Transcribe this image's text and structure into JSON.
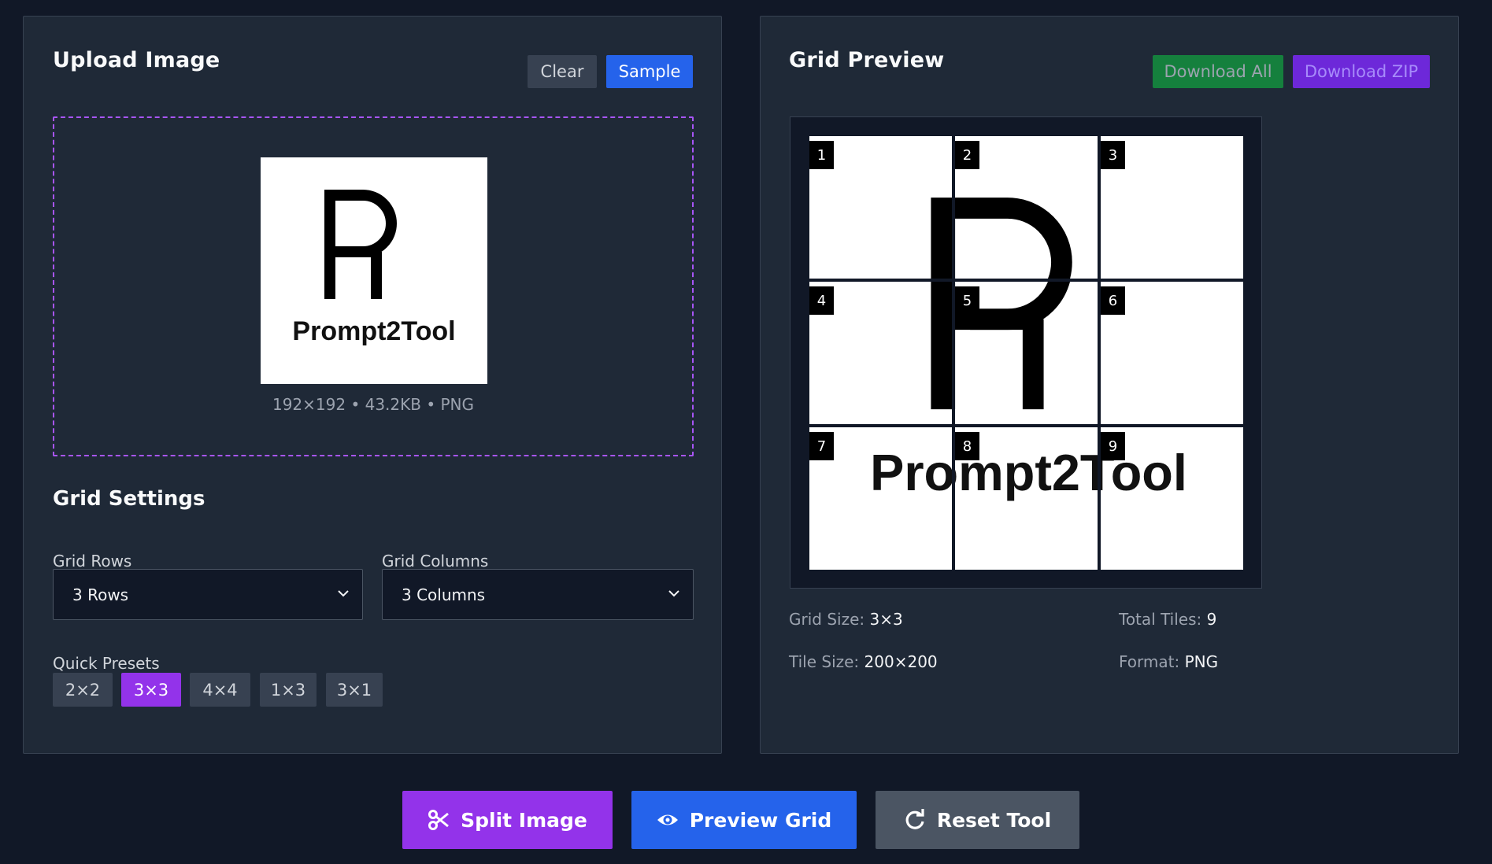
{
  "upload_panel": {
    "title": "Upload Image",
    "clear_label": "Clear",
    "sample_label": "Sample",
    "image_meta": "192×192 • 43.2KB • PNG",
    "logo_text": "Prompt2Tool"
  },
  "grid_settings": {
    "title": "Grid Settings",
    "rows_label": "Grid Rows",
    "rows_value": "3 Rows",
    "cols_label": "Grid Columns",
    "cols_value": "3 Columns",
    "presets_label": "Quick Presets",
    "presets": [
      "2×2",
      "3×3",
      "4×4",
      "1×3",
      "3×1"
    ],
    "active_preset": "3×3"
  },
  "preview_panel": {
    "title": "Grid Preview",
    "download_all_label": "Download All",
    "download_zip_label": "Download ZIP",
    "tile_numbers": [
      "1",
      "2",
      "3",
      "4",
      "5",
      "6",
      "7",
      "8",
      "9"
    ],
    "stats": {
      "grid_size_label": "Grid Size:",
      "grid_size_value": "3×3",
      "total_tiles_label": "Total Tiles:",
      "total_tiles_value": "9",
      "tile_size_label": "Tile Size:",
      "tile_size_value": "200×200",
      "format_label": "Format:",
      "format_value": "PNG"
    }
  },
  "actions": {
    "split_label": "Split Image",
    "preview_label": "Preview Grid",
    "reset_label": "Reset Tool"
  },
  "colors": {
    "background": "#111827",
    "panel": "#1f2937",
    "purple_accent": "#9333ea",
    "blue_accent": "#2563eb",
    "green_accent": "#15803d"
  }
}
